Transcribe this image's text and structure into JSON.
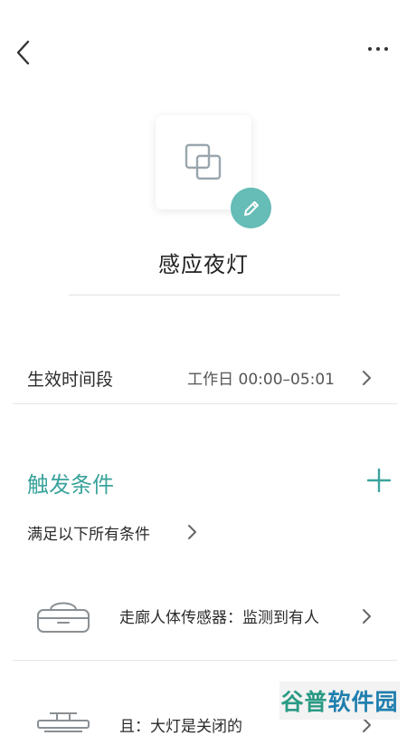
{
  "header": {
    "back_icon": "chevron-left-icon",
    "more_icon": "more-dots-icon"
  },
  "scene": {
    "icon": "overlap-squares-icon",
    "edit_icon": "pencil-icon",
    "name": "感应夜灯"
  },
  "effective_time": {
    "label": "生效时间段",
    "value": "工作日 00:00–05:01"
  },
  "trigger": {
    "title": "触发条件",
    "add_icon": "plus-icon",
    "mode": "满足以下所有条件",
    "conditions": [
      {
        "icon": "motion-sensor-icon",
        "text": "走廊人体传感器：监测到有人"
      },
      {
        "icon": "ceiling-light-icon",
        "text": "且：大灯是关闭的"
      }
    ]
  },
  "watermark": {
    "part1": "谷普",
    "part2": "软件园"
  },
  "colors": {
    "accent": "#3aa39c",
    "badge": "#66bcb7",
    "divider": "#e6e6e6"
  }
}
